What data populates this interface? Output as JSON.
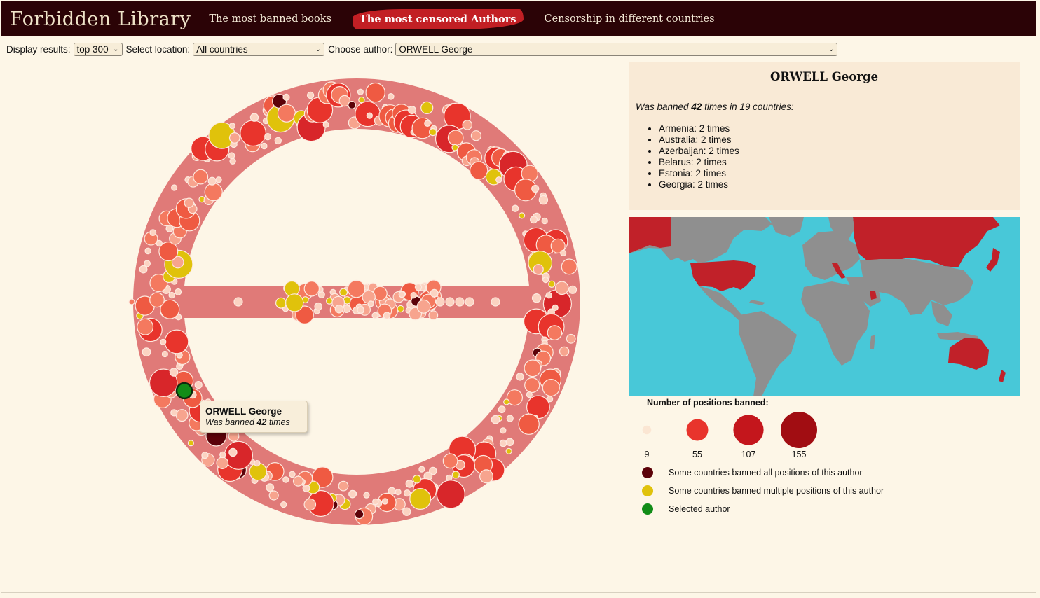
{
  "header": {
    "brand": "Forbidden Library",
    "nav": [
      {
        "label": "The most banned books",
        "active": false
      },
      {
        "label": "The most censored Authors",
        "active": true
      },
      {
        "label": "Censorship in different countries",
        "active": false
      }
    ]
  },
  "controls": {
    "display_label": "Display results:",
    "display_value": "top 300",
    "location_label": "Select location:",
    "location_value": "All countries",
    "author_label": "Choose author:",
    "author_value": "ORWELL George"
  },
  "tooltip": {
    "name": "ORWELL George",
    "prefix": "Was banned ",
    "count": "42",
    "suffix": " times"
  },
  "info": {
    "title": "ORWELL George",
    "summary_prefix": "Was banned ",
    "summary_count": "42",
    "summary_suffix": " times in 19 countries:",
    "countries": [
      "Armenia: 2 times",
      "Australia: 2 times",
      "Azerbaijan: 2 times",
      "Belarus: 2 times",
      "Estonia: 2 times",
      "Georgia: 2 times"
    ]
  },
  "legend": {
    "title": "Number of positions banned:",
    "sizes": [
      {
        "value": 9,
        "label": "9",
        "color": "#fbe6d3"
      },
      {
        "value": 55,
        "label": "55",
        "color": "#e8342c"
      },
      {
        "value": 107,
        "label": "107",
        "color": "#c4161c"
      },
      {
        "value": 155,
        "label": "155",
        "color": "#a10d12"
      }
    ],
    "keys": [
      {
        "label": "Some countries banned all positions of this author",
        "color": "#5c0209"
      },
      {
        "label": "Some countries banned multiple positions of this author",
        "color": "#e0c20b"
      },
      {
        "label": "Selected author",
        "color": "#118c17"
      }
    ]
  },
  "colors": {
    "ring": "#e07a78",
    "banned_all": "#5c0209",
    "banned_multiple": "#e0c20b",
    "selected": "#118c17",
    "map_water": "#48c8d8",
    "map_land": "#8f8f8f",
    "map_banned": "#c12129"
  }
}
